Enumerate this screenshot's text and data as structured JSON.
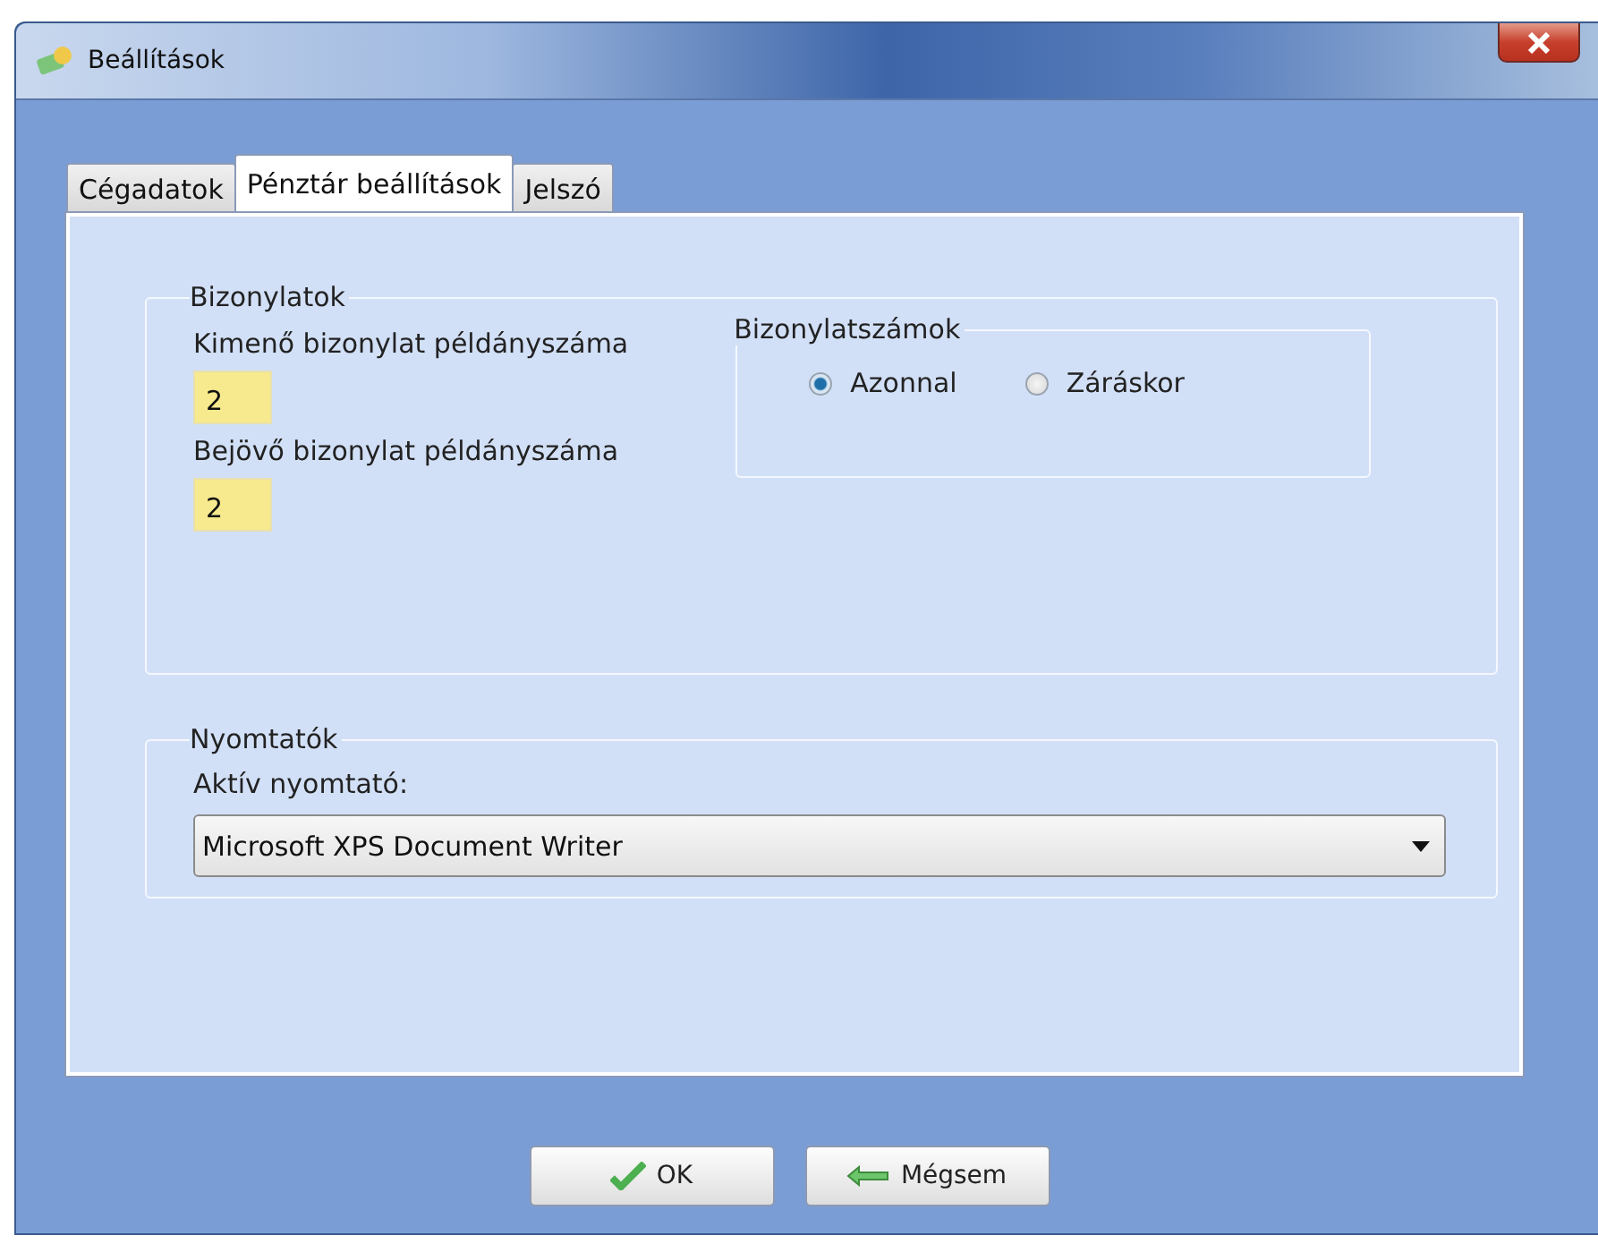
{
  "window": {
    "title": "Beállítások"
  },
  "tabs": [
    {
      "label": "Cégadatok",
      "selected": false
    },
    {
      "label": "Pénztár beállítások",
      "selected": true
    },
    {
      "label": "Jelszó",
      "selected": false
    }
  ],
  "documents": {
    "title": "Bizonylatok",
    "fields": [
      {
        "label": "Kimenő bizonylat példányszáma",
        "value": "2"
      },
      {
        "label": "Bejövő bizonylat példányszáma",
        "value": "2"
      }
    ],
    "numbering": {
      "title": "Bizonylatszámok",
      "options": [
        {
          "label": "Azonnal",
          "selected": true
        },
        {
          "label": "Záráskor",
          "selected": false
        }
      ]
    }
  },
  "printers": {
    "title": "Nyomtatók",
    "label": "Aktív nyomtató:",
    "value": "Microsoft XPS Document Writer"
  },
  "buttons": [
    {
      "kind": "ok",
      "label": "OK"
    },
    {
      "kind": "cancel",
      "label": "Mégsem"
    }
  ]
}
